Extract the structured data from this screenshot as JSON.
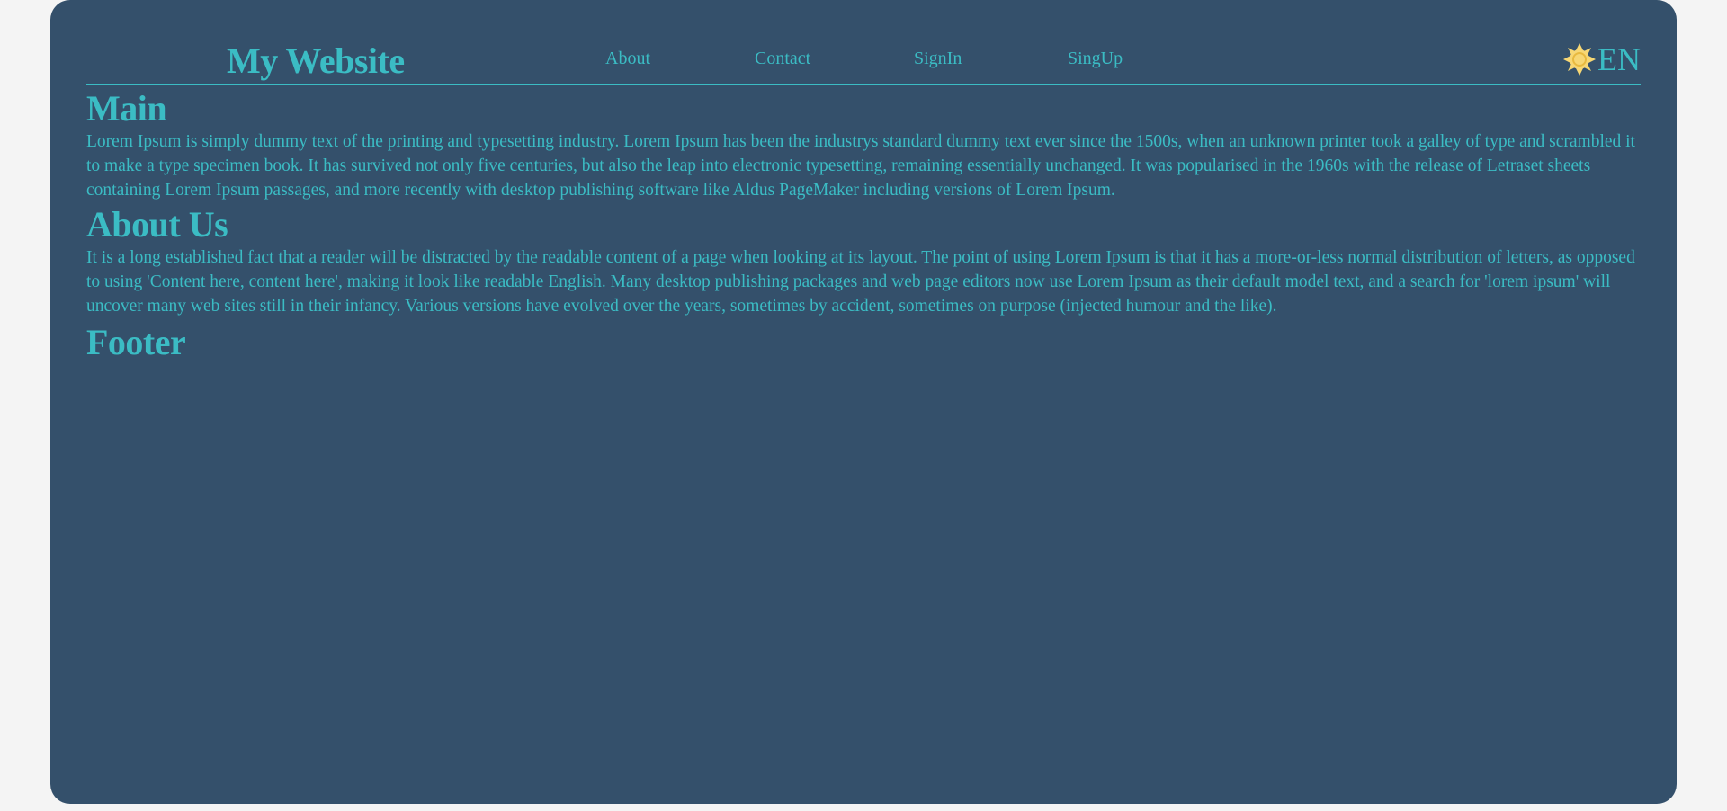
{
  "header": {
    "site_title": "My Website",
    "nav": {
      "about": "About",
      "contact": "Contact",
      "signin": "SignIn",
      "signup": "SingUp"
    },
    "language": "EN",
    "theme_icon": "sun-icon"
  },
  "main": {
    "title": "Main",
    "text": "Lorem Ipsum is simply dummy text of the printing and typesetting industry. Lorem Ipsum has been the industrys standard dummy text ever since the 1500s, when an unknown printer took a galley of type and scrambled it to make a type specimen book. It has survived not only five centuries, but also the leap into electronic typesetting, remaining essentially unchanged. It was popularised in the 1960s with the release of Letraset sheets containing Lorem Ipsum passages, and more recently with desktop publishing software like Aldus PageMaker including versions of Lorem Ipsum."
  },
  "about": {
    "title": "About Us",
    "text": "It is a long established fact that a reader will be distracted by the readable content of a page when looking at its layout. The point of using Lorem Ipsum is that it has a more-or-less normal distribution of letters, as opposed to using 'Content here, content here', making it look like readable English. Many desktop publishing packages and web page editors now use Lorem Ipsum as their default model text, and a search for 'lorem ipsum' will uncover many web sites still in their infancy. Various versions have evolved over the years, sometimes by accident, sometimes on purpose (injected humour and the like)."
  },
  "footer": {
    "title": "Footer"
  },
  "colors": {
    "page_background": "#f4f4f4",
    "card_background": "#34506b",
    "accent": "#3bbcc4",
    "sun": "#f7d774"
  }
}
